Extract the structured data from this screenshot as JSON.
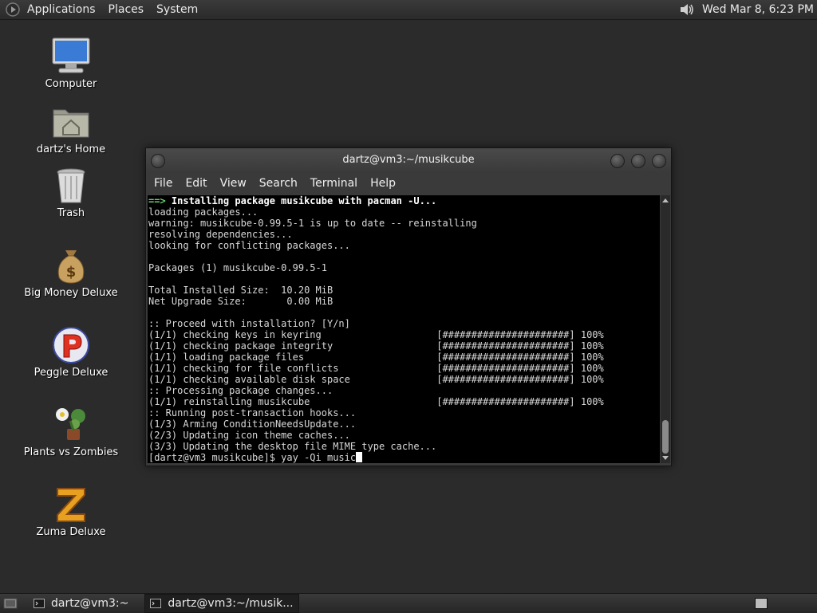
{
  "top_panel": {
    "menus": [
      "Applications",
      "Places",
      "System"
    ],
    "clock": "Wed Mar  8,  6:23 PM",
    "icons": {
      "apps": "gnome-foot-icon",
      "volume": "speaker-icon"
    }
  },
  "desktop": {
    "icons": [
      {
        "label": "Computer",
        "icon": "computer-icon"
      },
      {
        "label": "dartz's Home",
        "icon": "home-folder-icon"
      },
      {
        "label": "Trash",
        "icon": "trash-icon"
      },
      {
        "label": "Big Money Deluxe",
        "icon": "money-bag-icon"
      },
      {
        "label": "Peggle Deluxe",
        "icon": "peggle-icon"
      },
      {
        "label": "Plants vs Zombies",
        "icon": "plant-icon"
      },
      {
        "label": "Zuma Deluxe",
        "icon": "zuma-icon"
      }
    ]
  },
  "terminal": {
    "title": "dartz@vm3:~/musikcube",
    "menu": [
      "File",
      "Edit",
      "View",
      "Search",
      "Terminal",
      "Help"
    ],
    "lines": [
      {
        "type": "arrow",
        "prefix": "==>",
        "text": " Installing package musikcube with pacman -U..."
      },
      {
        "type": "plain",
        "text": "loading packages..."
      },
      {
        "type": "plain",
        "text": "warning: musikcube-0.99.5-1 is up to date -- reinstalling"
      },
      {
        "type": "plain",
        "text": "resolving dependencies..."
      },
      {
        "type": "plain",
        "text": "looking for conflicting packages..."
      },
      {
        "type": "plain",
        "text": ""
      },
      {
        "type": "plain",
        "text": "Packages (1) musikcube-0.99.5-1"
      },
      {
        "type": "plain",
        "text": ""
      },
      {
        "type": "plain",
        "text": "Total Installed Size:  10.20 MiB"
      },
      {
        "type": "plain",
        "text": "Net Upgrade Size:       0.00 MiB"
      },
      {
        "type": "plain",
        "text": ""
      },
      {
        "type": "plain",
        "text": ":: Proceed with installation? [Y/n]"
      },
      {
        "type": "plain",
        "text": "(1/1) checking keys in keyring                    [######################] 100%"
      },
      {
        "type": "plain",
        "text": "(1/1) checking package integrity                  [######################] 100%"
      },
      {
        "type": "plain",
        "text": "(1/1) loading package files                       [######################] 100%"
      },
      {
        "type": "plain",
        "text": "(1/1) checking for file conflicts                 [######################] 100%"
      },
      {
        "type": "plain",
        "text": "(1/1) checking available disk space               [######################] 100%"
      },
      {
        "type": "plain",
        "text": ":: Processing package changes..."
      },
      {
        "type": "plain",
        "text": "(1/1) reinstalling musikcube                      [######################] 100%"
      },
      {
        "type": "plain",
        "text": ":: Running post-transaction hooks..."
      },
      {
        "type": "plain",
        "text": "(1/3) Arming ConditionNeedsUpdate..."
      },
      {
        "type": "plain",
        "text": "(2/3) Updating icon theme caches..."
      },
      {
        "type": "plain",
        "text": "(3/3) Updating the desktop file MIME type cache..."
      },
      {
        "type": "prompt",
        "text": "[dartz@vm3 musikcube]$ yay -Qi music"
      }
    ]
  },
  "bottom_panel": {
    "tasks": [
      {
        "label": "dartz@vm3:~",
        "active": false
      },
      {
        "label": "dartz@vm3:~/musik...",
        "active": true
      }
    ]
  }
}
